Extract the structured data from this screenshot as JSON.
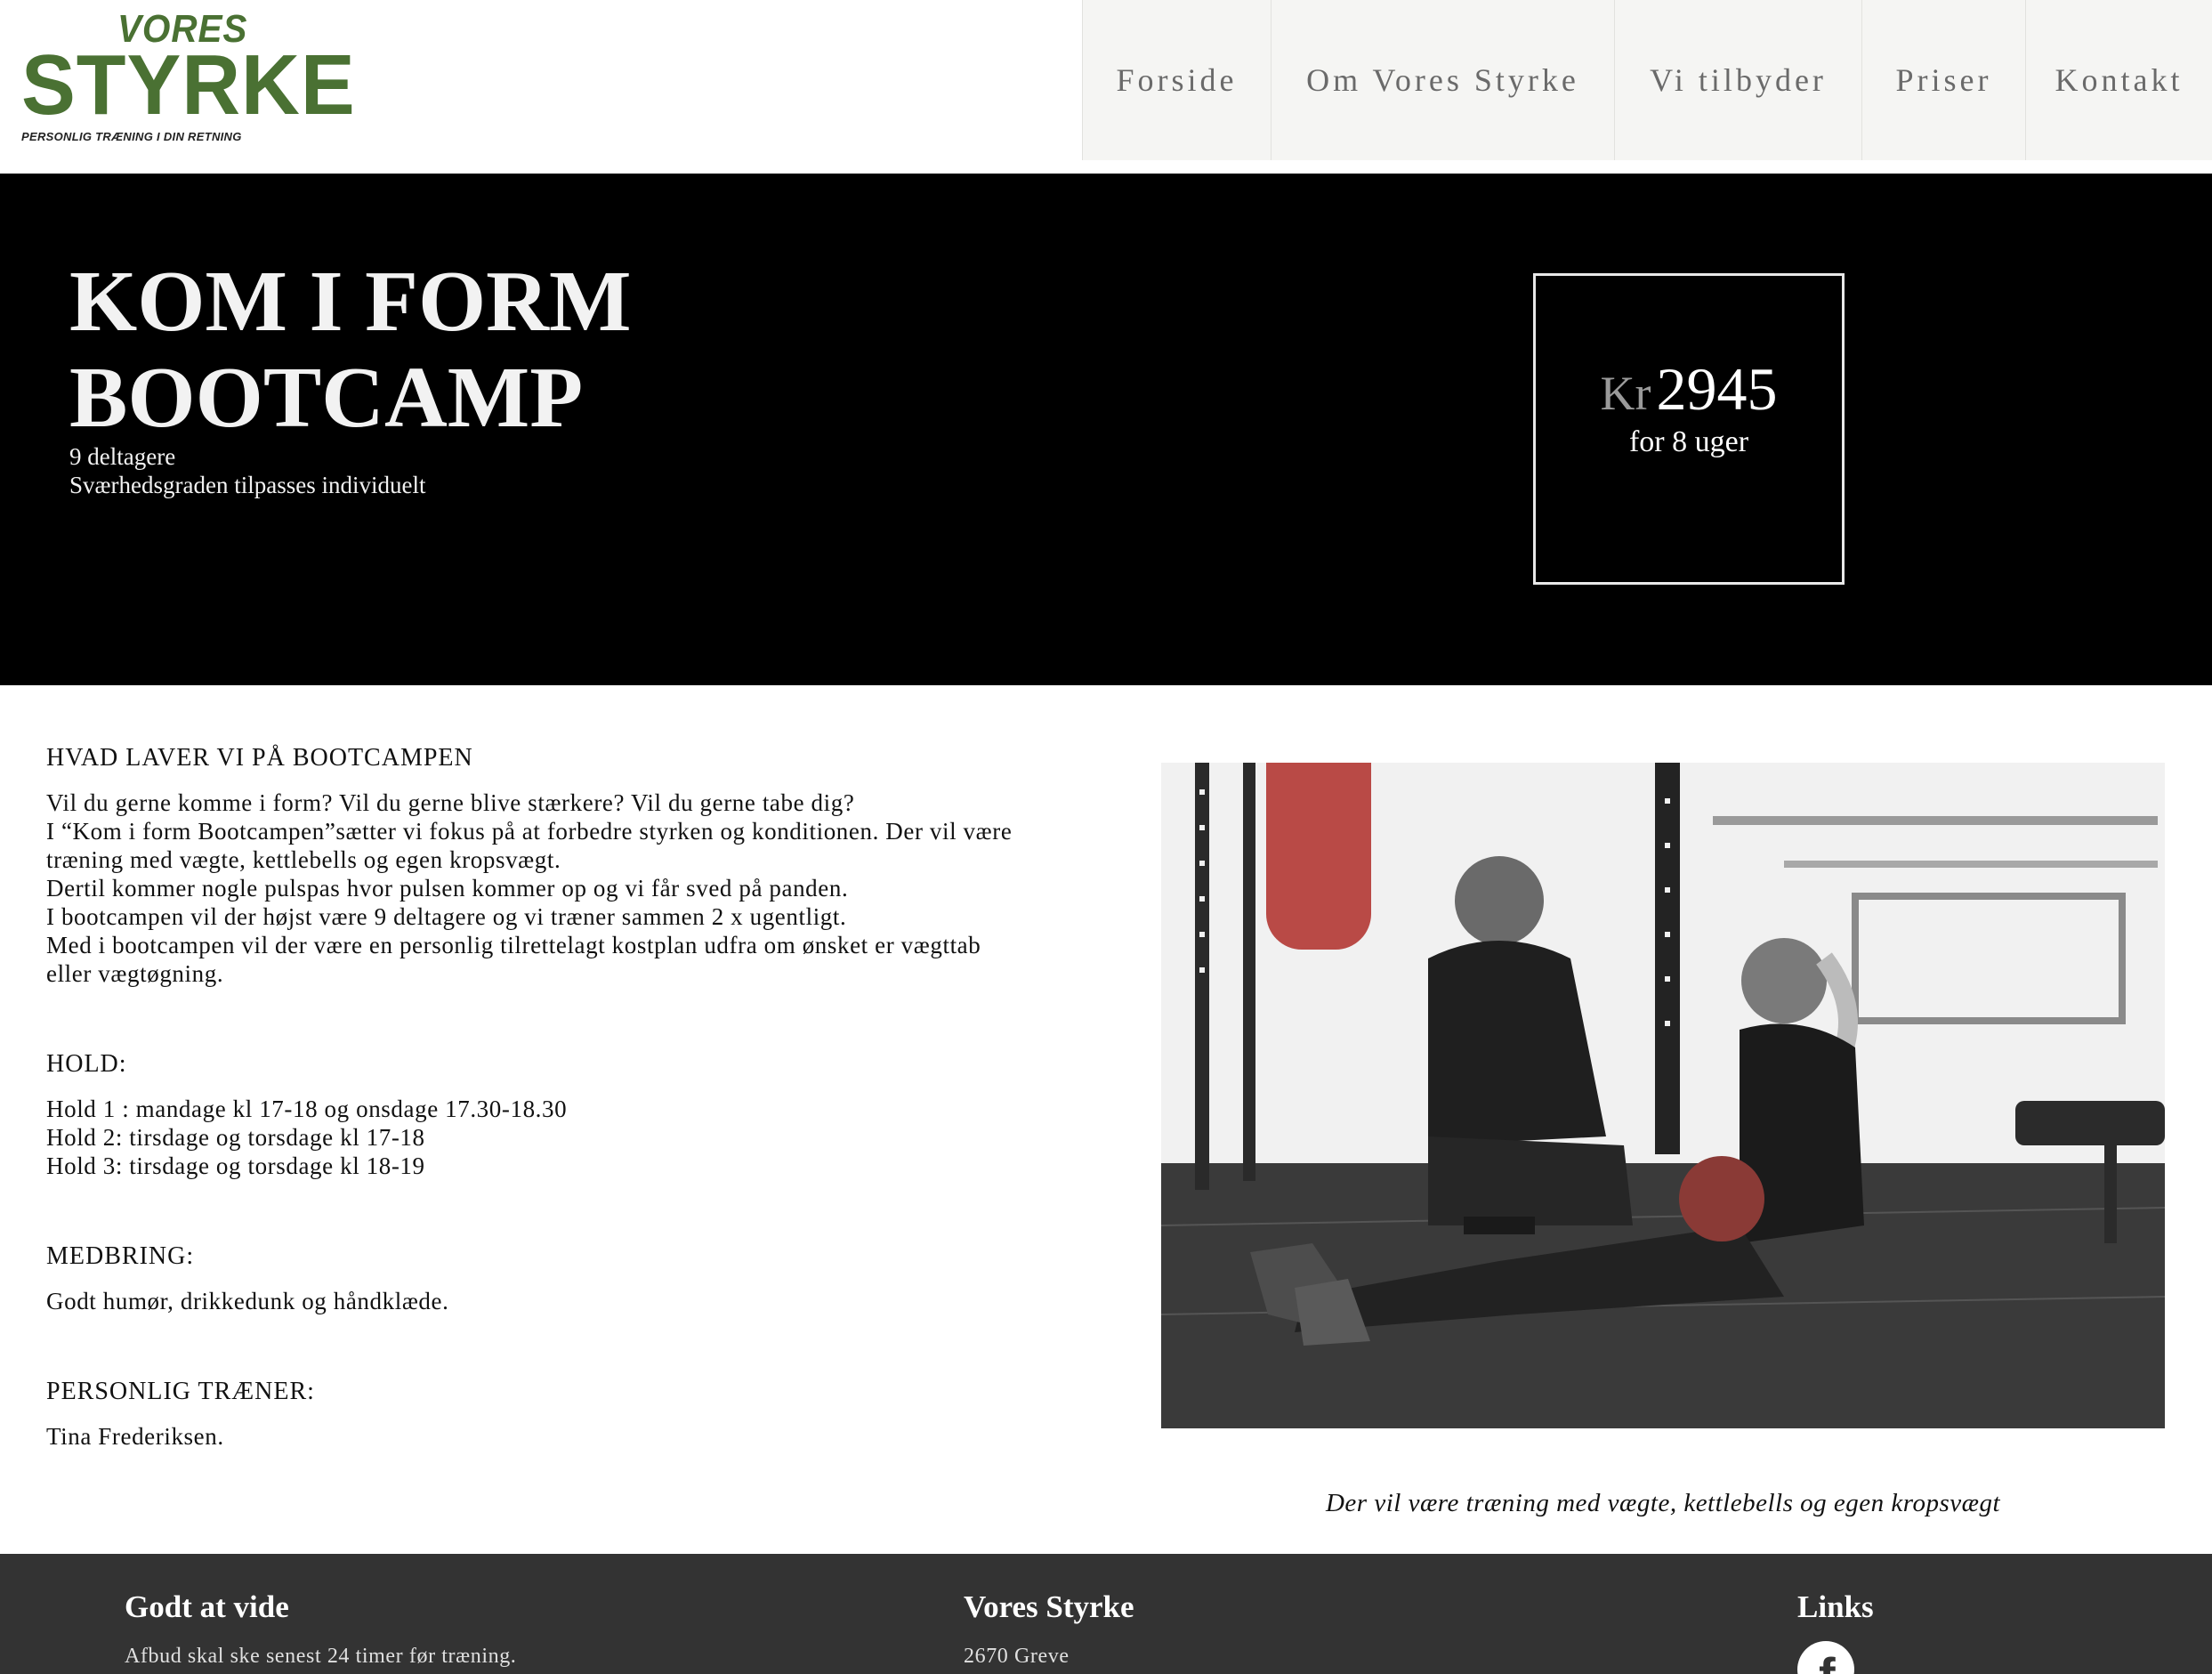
{
  "header": {
    "logo": {
      "line1": "VORES",
      "line2": "STYRKE",
      "tagline": "PERSONLIG TRÆNING I DIN RETNING"
    },
    "nav": [
      "Forside",
      "Om Vores Styrke",
      "Vi tilbyder",
      "Priser",
      "Kontakt"
    ]
  },
  "hero": {
    "title_line1": "KOM I FORM",
    "title_line2": "BOOTCAMP",
    "sub_line1": "9 deltagere",
    "sub_line2": "Sværhedsgraden tilpasses individuelt",
    "price": {
      "currency": "Kr",
      "amount": "2945",
      "period": "for 8 uger"
    }
  },
  "content": {
    "section1": {
      "title": "HVAD LAVER VI PÅ BOOTCAMPEN",
      "lines": [
        "Vil du gerne komme i form? Vil du gerne blive stærkere? Vil du gerne tabe dig?",
        "I “Kom i form Bootcampen”sætter vi fokus på at forbedre styrken og konditionen. Der vil være",
        "træning med vægte, kettlebells og egen kropsvægt.",
        "Dertil kommer nogle pulspas hvor pulsen kommer op og vi får sved på panden.",
        "I bootcampen vil der højst være 9 deltagere og vi træner sammen 2 x ugentligt.",
        "Med i bootcampen vil der være en personlig tilrettelagt kostplan udfra om ønsket er vægttab",
        "eller vægtøgning."
      ]
    },
    "section2": {
      "title": "HOLD:",
      "lines": [
        "Hold 1 : mandage kl 17-18 og onsdage 17.30-18.30",
        "Hold 2: tirsdage og torsdage kl 17-18",
        "Hold 3: tirsdage og torsdage kl 18-19"
      ]
    },
    "section3": {
      "title": "MEDBRING:",
      "lines": [
        "Godt humør, drikkedunk og håndklæde."
      ]
    },
    "section4": {
      "title": "PERSONLIG TRÆNER:",
      "lines": [
        "Tina Frederiksen."
      ]
    },
    "image_caption": "Der vil være træning med vægte, kettlebells og egen kropsvægt"
  },
  "footer": {
    "col1": {
      "heading": "Godt at vide",
      "text": "Afbud skal ske senest 24 timer før træning."
    },
    "col2": {
      "heading": "Vores Styrke",
      "text": "2670 Greve"
    },
    "col3": {
      "heading": "Links",
      "icon": "facebook-icon"
    }
  },
  "colors": {
    "brand_green": "#4a7133",
    "hero_bg": "#000000",
    "nav_bg": "#f5f5f3",
    "footer_bg": "#333333"
  }
}
